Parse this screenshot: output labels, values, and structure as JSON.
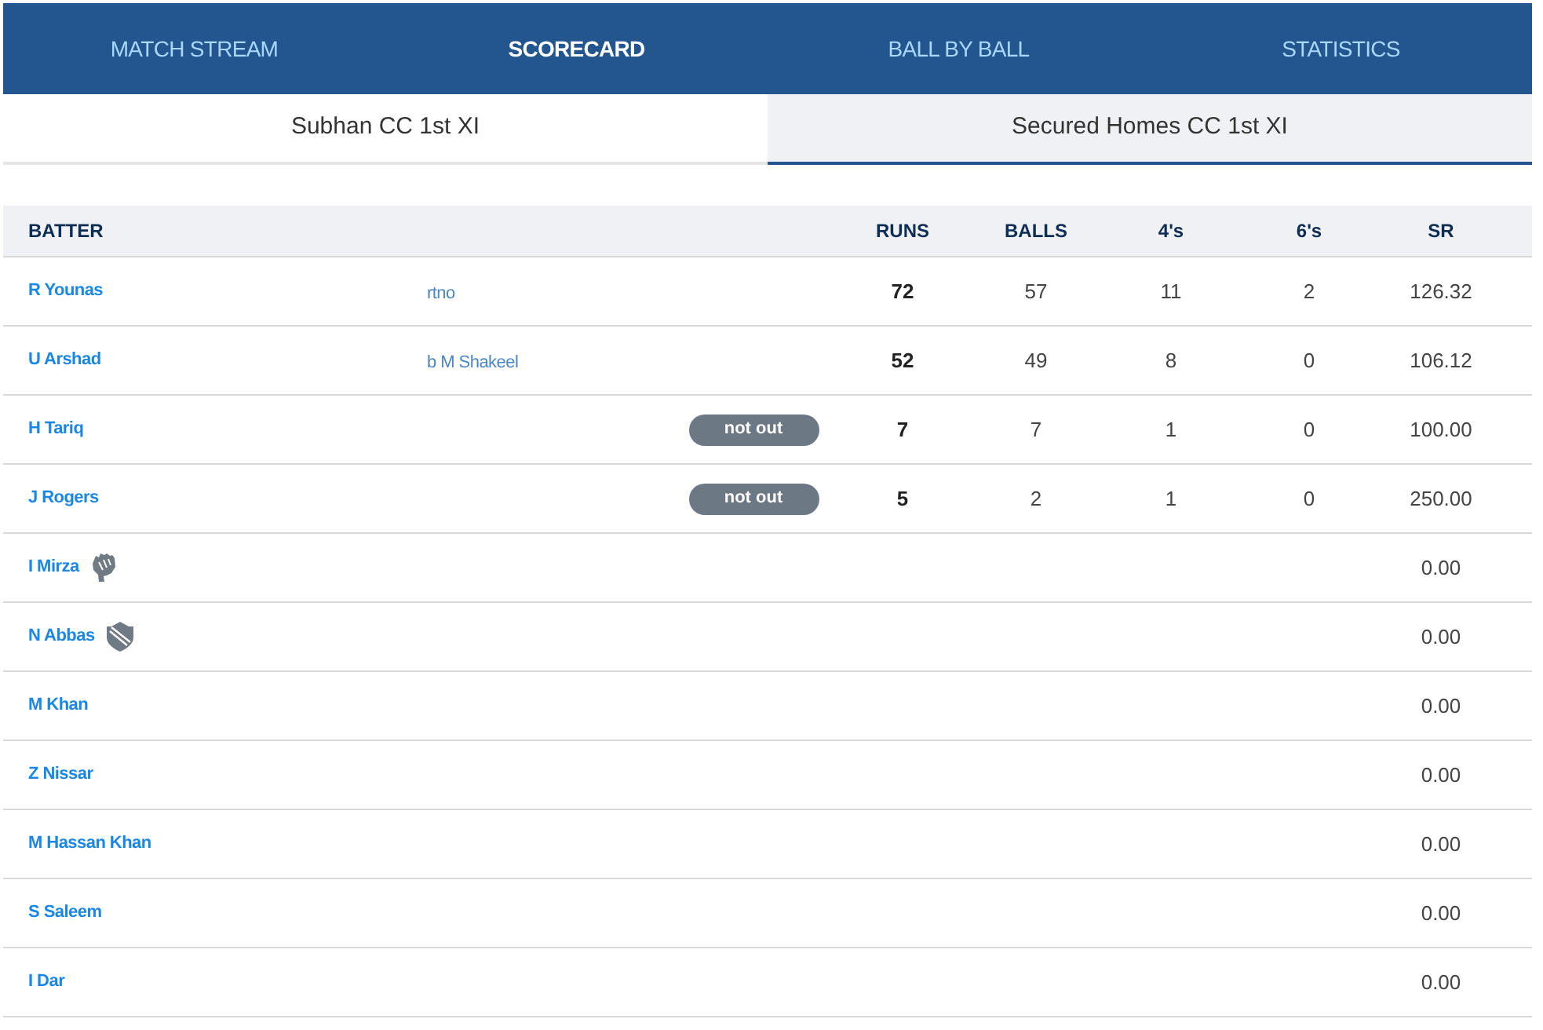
{
  "tabs": [
    {
      "label": "MATCH STREAM",
      "selected": false
    },
    {
      "label": "SCORECARD",
      "selected": true
    },
    {
      "label": "BALL BY BALL",
      "selected": false
    },
    {
      "label": "STATISTICS",
      "selected": false
    }
  ],
  "team_tabs": [
    {
      "label": "Subhan CC 1st XI",
      "selected": false
    },
    {
      "label": "Secured Homes CC 1st XI",
      "selected": true
    }
  ],
  "table": {
    "columns": [
      "BATTER",
      "RUNS",
      "BALLS",
      "4's",
      "6's",
      "SR"
    ],
    "rows": [
      {
        "kind": "player",
        "batter": "R Younas",
        "dismissal": "rtno",
        "runs": "72",
        "balls": "57",
        "fours": "11",
        "sixes": "2",
        "sr": "126.32"
      },
      {
        "kind": "player",
        "batter": "U Arshad",
        "dismissal": "b M Shakeel",
        "runs": "52",
        "balls": "49",
        "fours": "8",
        "sixes": "0",
        "sr": "106.12"
      },
      {
        "kind": "player",
        "batter": "H Tariq",
        "status": "not out",
        "runs": "7",
        "balls": "7",
        "fours": "1",
        "sixes": "0",
        "sr": "100.00"
      },
      {
        "kind": "player",
        "batter": "J Rogers",
        "status": "not out",
        "runs": "5",
        "balls": "2",
        "fours": "1",
        "sixes": "0",
        "sr": "250.00"
      },
      {
        "kind": "keeper",
        "batter": "I Mirza",
        "sr": "0.00"
      },
      {
        "kind": "captain",
        "batter": "N Abbas",
        "sr": "0.00"
      },
      {
        "kind": "player",
        "batter": "M Khan",
        "sr": "0.00"
      },
      {
        "kind": "player",
        "batter": "Z Nissar",
        "sr": "0.00"
      },
      {
        "kind": "player",
        "batter": "M Hassan Khan",
        "sr": "0.00"
      },
      {
        "kind": "player",
        "batter": "S Saleem",
        "sr": "0.00"
      },
      {
        "kind": "player",
        "batter": "I Dar",
        "sr": "0.00"
      }
    ]
  }
}
